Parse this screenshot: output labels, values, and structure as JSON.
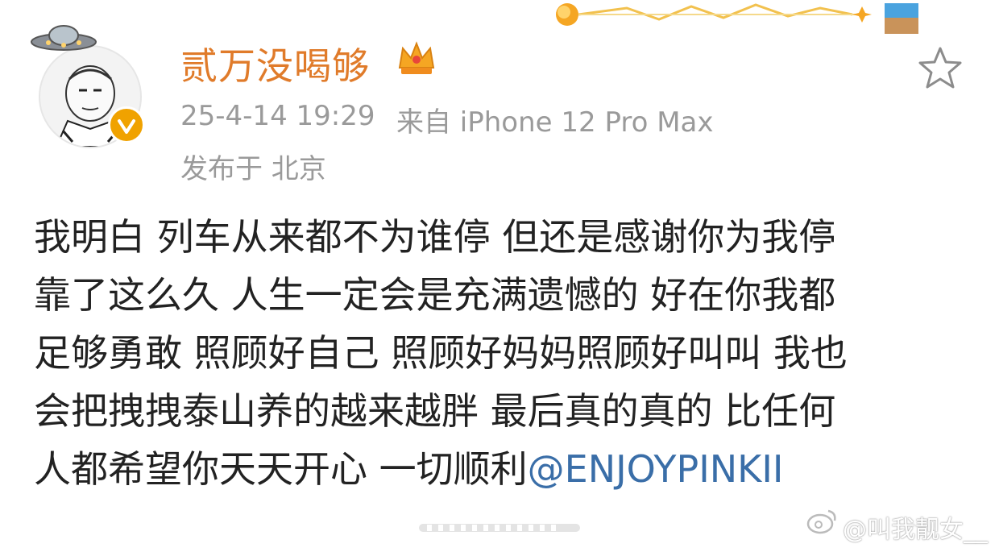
{
  "post": {
    "username": "贰万没喝够",
    "time": "25-4-14 19:29",
    "source": "来自 iPhone 12 Pro Max",
    "location": "发布于 北京",
    "body_lines": [
      "我明白 列车从来都不为谁停 但还是感谢你为我停",
      "靠了这么久 人生一定会是充满遗憾的 好在你我都",
      "足够勇敢 照顾好自己 照顾好妈妈照顾好叫叫 我也",
      "会把拽拽泰山养的越来越胖 最后真的真的 比任何"
    ],
    "last_line_text": "人都希望你天天开心 一切顺利",
    "mention": "@ENJOYPINKII"
  },
  "watermark": {
    "text": "@叫我靓女__"
  },
  "icons": {
    "avatar": "avatar-cartoon",
    "ufo": "ufo-icon",
    "verified": "verified-badge-icon",
    "crown": "crown-icon",
    "star": "star-icon",
    "weibo": "weibo-logo-icon"
  },
  "colors": {
    "username": "#e07b2a",
    "meta": "#9a9a9a",
    "mention": "#3a6ea8",
    "verified": "#f0a200"
  }
}
